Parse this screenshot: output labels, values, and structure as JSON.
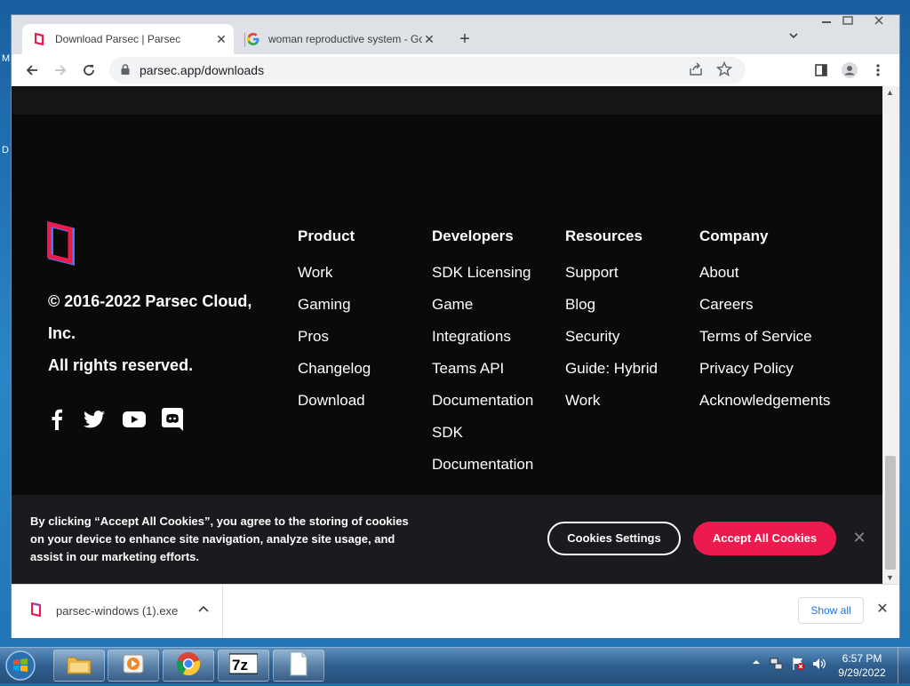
{
  "browser": {
    "tabs": [
      {
        "title": "Download Parsec | Parsec",
        "close": "✕"
      },
      {
        "title": "woman reproductive system - Go",
        "close": "✕"
      }
    ],
    "new_tab": "+",
    "tab_search": "⌄",
    "address": "parsec.app/downloads"
  },
  "footer": {
    "copyright": [
      "© 2016-2022 Parsec Cloud,",
      "Inc.",
      "All rights reserved."
    ],
    "columns": [
      {
        "heading": "Product",
        "links": [
          "Work",
          "Gaming",
          "Pros",
          "Changelog",
          "Download"
        ]
      },
      {
        "heading": "Developers",
        "links": [
          "SDK Licensing",
          "Game",
          "Integrations",
          "Teams API",
          "Documentation",
          "SDK",
          "Documentation"
        ]
      },
      {
        "heading": "Resources",
        "links": [
          "Support",
          "Blog",
          "Security",
          "Guide: Hybrid",
          "Work"
        ]
      },
      {
        "heading": "Company",
        "links": [
          "About",
          "Careers",
          "Terms of Service",
          "Privacy Policy",
          "Acknowledgements"
        ]
      }
    ],
    "social_icons": [
      "facebook-icon",
      "twitter-icon",
      "youtube-icon",
      "discord-icon"
    ]
  },
  "cookie_banner": {
    "message": "By clicking “Accept All Cookies”, you agree to the storing of cookies on your device to enhance site navigation, analyze site usage, and assist in our marketing efforts.",
    "settings_label": "Cookies Settings",
    "accept_label": "Accept All Cookies",
    "close": "✕"
  },
  "download_bar": {
    "filename": "parsec-windows (1).exe",
    "show_all": "Show all",
    "close": "✕"
  },
  "taskbar": {
    "time": "6:57 PM",
    "date": "9/29/2022"
  },
  "desktop": {
    "letters": [
      "M",
      "D"
    ]
  },
  "colors": {
    "parsec_accent": "#ed1a4f",
    "page_bg": "#0a0a0a",
    "cookie_bg": "#1b1b1f"
  }
}
